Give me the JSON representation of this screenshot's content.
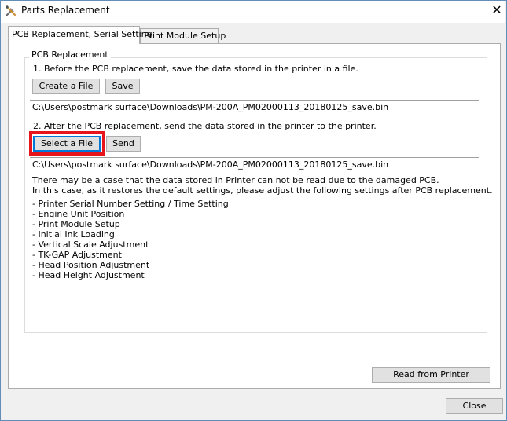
{
  "window": {
    "title": "Parts Replacement",
    "close_symbol": "✕"
  },
  "tabs": [
    {
      "label": "PCB Replacement, Serial Setting",
      "active": true
    },
    {
      "label": "Print Module Setup",
      "active": false
    }
  ],
  "group": {
    "title": "PCB Replacement",
    "step1_text": "1. Before the PCB replacement, save the data stored in the printer in a file.",
    "create_file_label": "Create a File",
    "save_label": "Save",
    "save_path": "C:\\Users\\postmark surface\\Downloads\\PM-200A_PM02000113_20180125_save.bin",
    "step2_text": "2. After the PCB replacement, send the data stored in the printer to the printer.",
    "select_file_label": "Select a File",
    "send_label": "Send",
    "send_path": "C:\\Users\\postmark surface\\Downloads\\PM-200A_PM02000113_20180125_save.bin",
    "notice_line1": "There may be a case that the data stored in Printer can not be read due to the damaged PCB.",
    "notice_line2": "In this case, as it restores the default settings, please adjust the following settings after PCB replacement.",
    "settings_list": [
      "- Printer Serial Number Setting / Time Setting",
      "- Engine Unit Position",
      "- Print Module Setup",
      "- Initial Ink Loading",
      "- Vertical Scale Adjustment",
      "- TK-GAP Adjustment",
      "- Head Position Adjustment",
      "- Head Height Adjustment"
    ]
  },
  "read_from_printer_label": "Read from Printer",
  "close_label": "Close",
  "colors": {
    "highlight": "#e8141c",
    "focus_border": "#0078d7",
    "window_bg": "#f0f0f0"
  },
  "icons": {
    "app_icon": "tools-icon"
  }
}
